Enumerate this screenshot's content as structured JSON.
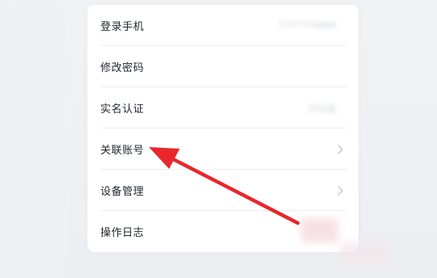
{
  "account_menu": {
    "items": [
      {
        "label": "登录手机",
        "value": "177****9089",
        "has_chevron": false
      },
      {
        "label": "修改密码",
        "value": "",
        "has_chevron": false
      },
      {
        "label": "实名认证",
        "value": "已认证",
        "has_chevron": false
      },
      {
        "label": "关联账号",
        "value": "",
        "has_chevron": true
      },
      {
        "label": "设备管理",
        "value": "",
        "has_chevron": true
      },
      {
        "label": "操作日志",
        "value": "",
        "has_chevron": false
      }
    ]
  },
  "annotation": {
    "arrow_color": "#e8262b",
    "target": "关联账号"
  },
  "colors": {
    "card_bg": "#ffffff",
    "page_bg": "#eef0f3",
    "label_text": "#23272e",
    "chevron": "#c4c8ce"
  }
}
